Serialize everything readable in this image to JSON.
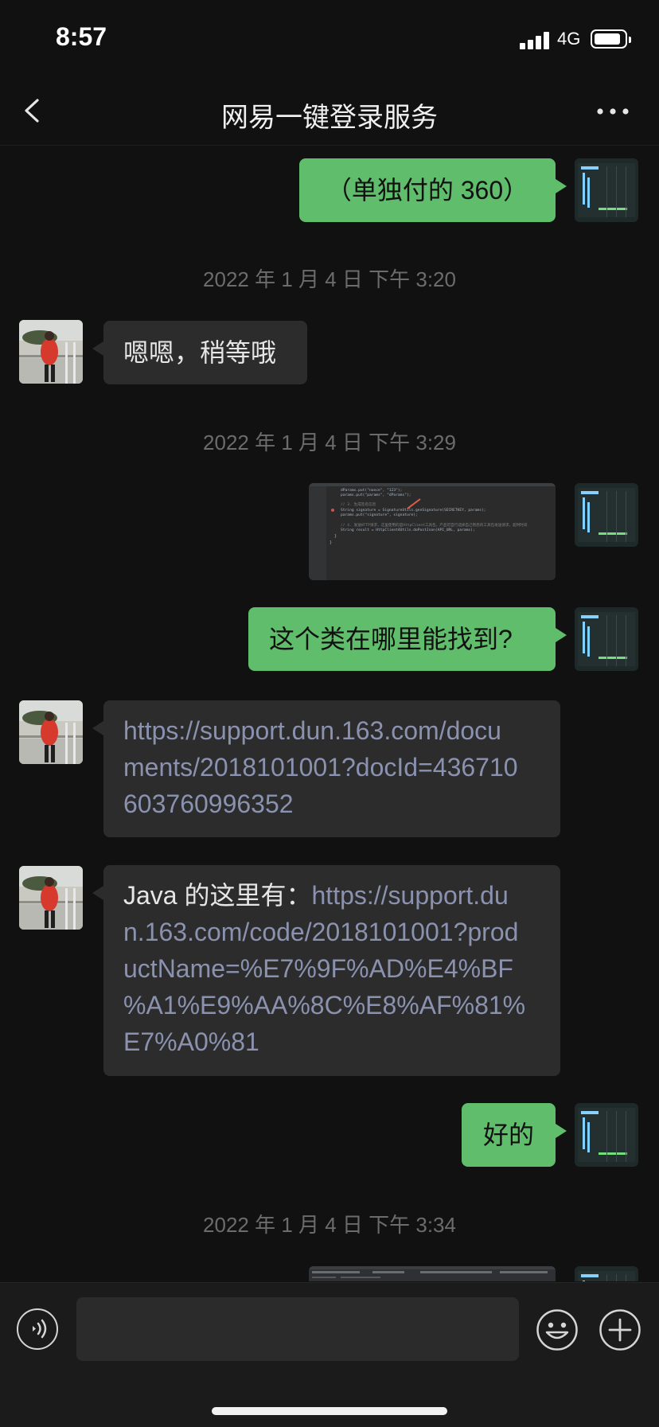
{
  "status_bar": {
    "time": "8:57",
    "network": "4G"
  },
  "header": {
    "title": "网易一键登录服务"
  },
  "messages": [
    {
      "side": "out",
      "text": "（单独付的 360）"
    },
    {
      "timestamp": "2022 年 1 月 4 日  下午 3:20"
    },
    {
      "side": "in",
      "text": "嗯嗯，稍等哦"
    },
    {
      "timestamp": "2022 年 1 月 4 日  下午 3:29"
    },
    {
      "side": "out",
      "type": "image",
      "image": {
        "content_lines": [
          "dParams.put(\"nonce\", \"123\");",
          "params.put(\"params\", \"dParams\");",
          "// 3. 生成签名信息",
          "String signature = SignatureUtils.genSignature(SECRETKEY, params);",
          "params.put(\"signature\", signature);",
          "// 4. 发送HTTP请求，这里使用的是HttpClient工具包，产品可自行选择自己熟悉的工具包发送请求，超时时间",
          "String result = HttpClient4Utils.doPostJson(API_URL, params);"
        ]
      }
    },
    {
      "side": "out",
      "text": "这个类在哪里能找到?"
    },
    {
      "side": "in",
      "lines": [
        "https://support.dun.163.com/docu",
        "ments/2018101001?docId=436710",
        "603760996352"
      ]
    },
    {
      "side": "in",
      "prefix": "Java 的这里有：",
      "lines": [
        "https://support.du",
        "n.163.com/code/2018101001?prod",
        "uctName=%E7%9F%AD%E4%BF",
        "%A1%E9%AA%8C%E8%AF%81%",
        "E7%A0%81"
      ]
    },
    {
      "side": "out",
      "text": "好的"
    },
    {
      "timestamp": "2022 年 1 月 4 日  下午 3:34"
    },
    {
      "side": "out",
      "type": "image"
    }
  ],
  "icons": {
    "back": "chevron-left-icon",
    "more": "more-dots-icon",
    "voice": "voice-icon",
    "emoji": "emoji-icon",
    "plus": "plus-icon"
  },
  "colors": {
    "outgoing_bubble": "#5fbd6b",
    "incoming_bubble": "#2c2c2c",
    "link": "#8a92b0",
    "background": "#111111"
  }
}
